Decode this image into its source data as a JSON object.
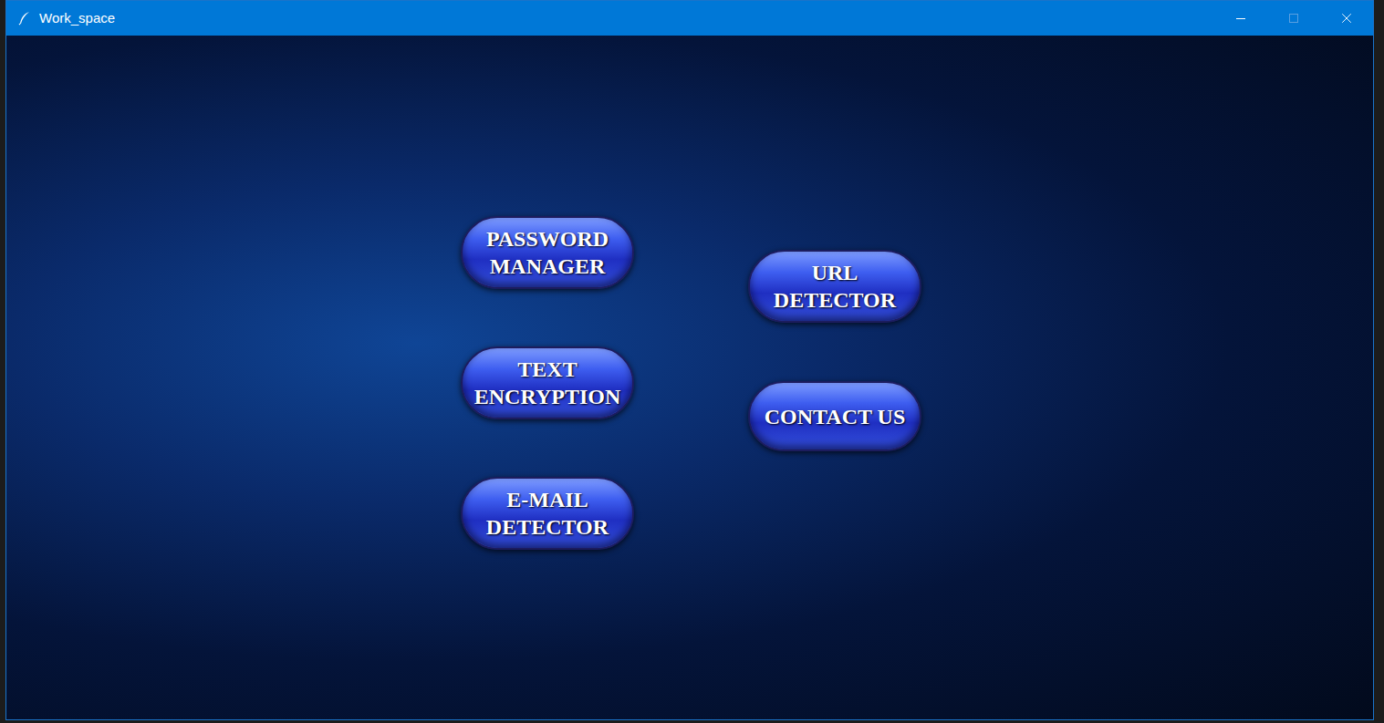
{
  "window": {
    "title": "Work_space",
    "maximize_disabled": true
  },
  "columns": [
    [
      {
        "lines": [
          "PASSWORD",
          "MANAGER"
        ]
      },
      {
        "lines": [
          "TEXT",
          "ENCRYPTION"
        ]
      },
      {
        "lines": [
          "E-MAIL",
          "DETECTOR"
        ]
      }
    ],
    [
      {
        "lines": [
          "URL",
          "DETECTOR"
        ]
      },
      {
        "lines": [
          "CONTACT US"
        ]
      }
    ]
  ]
}
